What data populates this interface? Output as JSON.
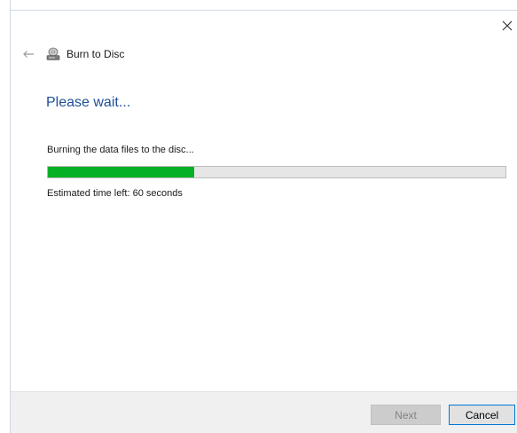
{
  "window": {
    "title": "Burn to Disc",
    "close_glyph": "✕",
    "back_glyph": "←"
  },
  "content": {
    "heading": "Please wait...",
    "status": "Burning the data files to the disc...",
    "progress_fraction": 0.32,
    "time_left": "Estimated time left: 60 seconds"
  },
  "footer": {
    "next_label": "Next",
    "cancel_label": "Cancel"
  },
  "colors": {
    "accent_heading": "#1f4e96",
    "progress_green": "#06b025",
    "focus_border": "#0078d7"
  },
  "icons": {
    "header": "disc-burner-icon",
    "back": "back-arrow-icon",
    "close": "close-icon"
  }
}
